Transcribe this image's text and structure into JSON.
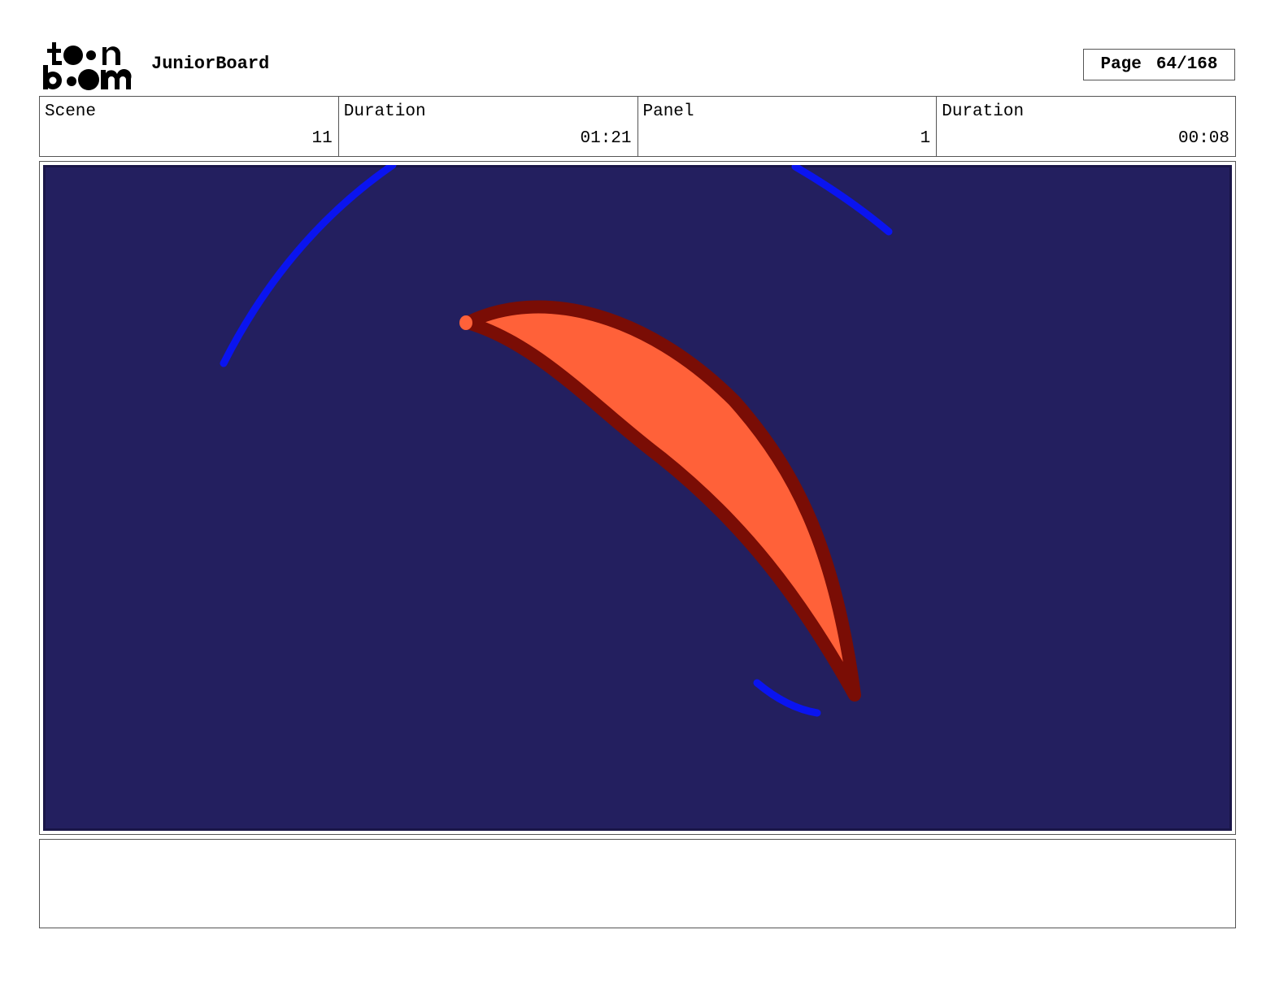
{
  "header": {
    "logo_icon": "toon-boom-logo",
    "app_name": "JuniorBoard",
    "page_label": "Page",
    "page_number": "64/168"
  },
  "info": {
    "scene_label": "Scene",
    "scene_value": "11",
    "scene_duration_label": "Duration",
    "scene_duration_value": "01:21",
    "panel_label": "Panel",
    "panel_value": "1",
    "panel_duration_label": "Duration",
    "panel_duration_value": "00:08"
  },
  "panel": {
    "background_color": "#231f5f",
    "stroke_blue": "#0a14f0",
    "shape_fill": "#ff6139",
    "shape_outline": "#7a0d05"
  },
  "notes": {
    "text": ""
  }
}
